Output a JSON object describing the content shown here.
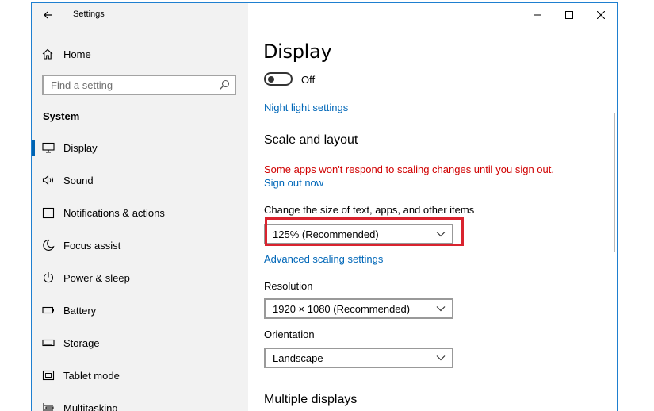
{
  "window": {
    "title": "Settings"
  },
  "sidebar": {
    "home_label": "Home",
    "search_placeholder": "Find a setting",
    "section_title": "System",
    "items": [
      {
        "label": "Display",
        "icon": "monitor-icon",
        "active": true
      },
      {
        "label": "Sound",
        "icon": "speaker-icon"
      },
      {
        "label": "Notifications & actions",
        "icon": "notification-icon"
      },
      {
        "label": "Focus assist",
        "icon": "moon-icon"
      },
      {
        "label": "Power & sleep",
        "icon": "power-icon"
      },
      {
        "label": "Battery",
        "icon": "battery-icon"
      },
      {
        "label": "Storage",
        "icon": "storage-icon"
      },
      {
        "label": "Tablet mode",
        "icon": "tablet-icon"
      },
      {
        "label": "Multitasking",
        "icon": "multitasking-icon"
      }
    ]
  },
  "main": {
    "title": "Display",
    "night_light_toggle": "Off",
    "night_light_link": "Night light settings",
    "scale_heading": "Scale and layout",
    "warning": "Some apps won't respond to scaling changes until you sign out.",
    "sign_out_link": "Sign out now",
    "size_label": "Change the size of text, apps, and other items",
    "size_value": "125% (Recommended)",
    "advanced_link": "Advanced scaling settings",
    "resolution_label": "Resolution",
    "resolution_value": "1920 × 1080 (Recommended)",
    "orientation_label": "Orientation",
    "orientation_value": "Landscape",
    "multiple_displays_heading": "Multiple displays"
  },
  "colors": {
    "accent": "#0067b8",
    "warning": "#d00000",
    "highlight": "#d9232e",
    "window_border": "#1e7fd0"
  }
}
